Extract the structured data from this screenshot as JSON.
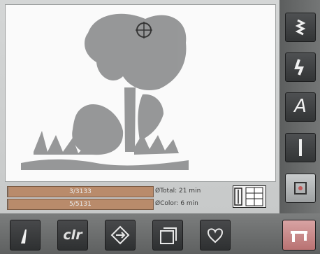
{
  "progress": {
    "stitch_counter": "3/3133",
    "stitch_fraction": 0.001,
    "color_counter": "5/5131",
    "color_fraction": 0.001
  },
  "time": {
    "total": "ØTotal: 21 min",
    "color": "ØColor: 6 min"
  },
  "side_buttons": [
    {
      "name": "stitch-icon"
    },
    {
      "name": "lightning-icon"
    },
    {
      "name": "alphabet-icon"
    },
    {
      "name": "single-bar-icon"
    },
    {
      "name": "embroidery-icon"
    }
  ],
  "side_labels": {
    "alphabet": "A"
  },
  "bottom_buttons": {
    "clr_label": "clr"
  },
  "colors": {
    "motif": "#8e8f90",
    "accent": "#c25a5a",
    "selection": "#e9c6c6"
  }
}
